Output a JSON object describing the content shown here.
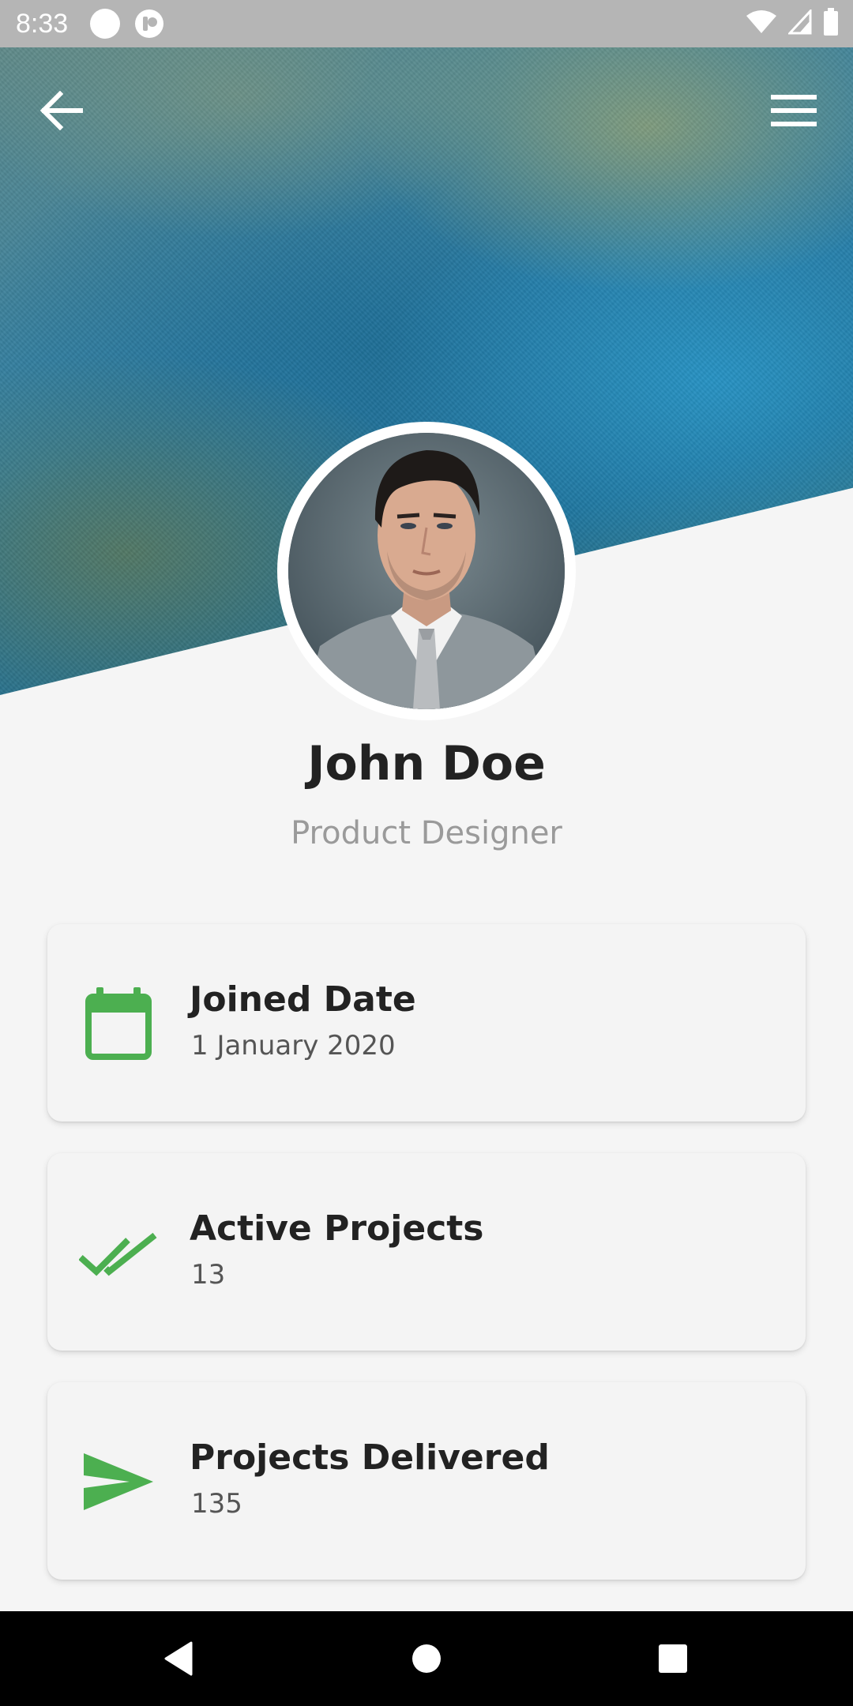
{
  "status_bar": {
    "time": "8:33"
  },
  "header": {
    "back_icon": "arrow-left-icon",
    "menu_icon": "hamburger-menu-icon"
  },
  "profile": {
    "name": "John Doe",
    "role": "Product Designer"
  },
  "stats": [
    {
      "icon": "calendar-icon",
      "title": "Joined Date",
      "value": "1 January 2020"
    },
    {
      "icon": "double-check-icon",
      "title": "Active Projects",
      "value": "13"
    },
    {
      "icon": "send-icon",
      "title": "Projects Delivered",
      "value": "135"
    }
  ],
  "colors": {
    "accent": "#4caf50",
    "status_bar": "#b5b5b5",
    "nav_bar": "#000000",
    "background": "#f5f5f5"
  }
}
